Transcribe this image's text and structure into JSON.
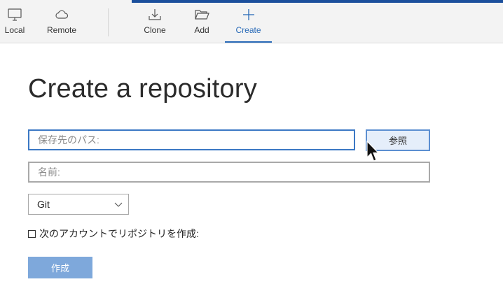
{
  "toolbar": {
    "local": {
      "label": "Local",
      "icon": "monitor-icon"
    },
    "remote": {
      "label": "Remote",
      "icon": "cloud-icon"
    },
    "clone": {
      "label": "Clone",
      "icon": "download-icon"
    },
    "add": {
      "label": "Add",
      "icon": "folder-open-icon"
    },
    "create": {
      "label": "Create",
      "icon": "plus-icon",
      "active": true
    }
  },
  "main": {
    "title": "Create a repository",
    "path": {
      "value": "",
      "placeholder": "保存先のパス:"
    },
    "browse_label": "参照",
    "name": {
      "value": "",
      "placeholder": "名前:"
    },
    "vcs_select": {
      "selected": "Git"
    },
    "account_checkbox": {
      "label": "次のアカウントでリポジトリを作成:",
      "checked": false
    },
    "create_label": "作成"
  },
  "colors": {
    "accent": "#2a6bb8",
    "header_strip": "#1b4f9c",
    "create_button": "#7ea8db",
    "focus_border": "#3b78c4"
  }
}
